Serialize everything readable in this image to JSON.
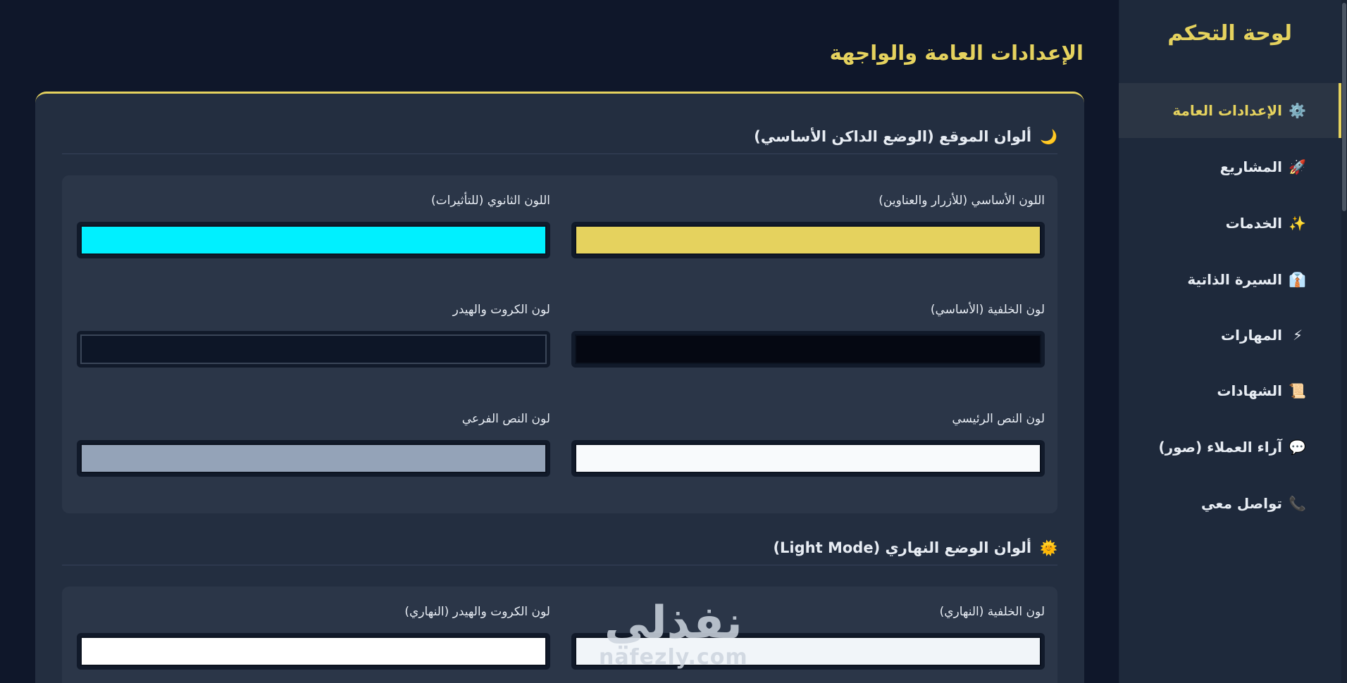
{
  "sidebar": {
    "title": "لوحة التحكم",
    "items": [
      {
        "label": "الإعدادات العامة",
        "icon": "⚙️",
        "active": true
      },
      {
        "label": "المشاريع",
        "icon": "🚀"
      },
      {
        "label": "الخدمات",
        "icon": "✨"
      },
      {
        "label": "السيرة الذاتية",
        "icon": "👔"
      },
      {
        "label": "المهارات",
        "icon": "⚡"
      },
      {
        "label": "الشهادات",
        "icon": "📜"
      },
      {
        "label": "آراء العملاء (صور)",
        "icon": "💬"
      },
      {
        "label": "تواصل معي",
        "icon": "📞"
      }
    ]
  },
  "main": {
    "title": "الإعدادات العامة والواجهة",
    "dark_section": {
      "icon": "🌙",
      "title": "ألوان الموقع (الوضع الداكن الأساسي)",
      "fields": [
        {
          "label": "اللون الأساسي (للأزرار والعناوين)",
          "color": "#e5d25e"
        },
        {
          "label": "اللون الثانوي (للتأثيرات)",
          "color": "#00f0ff"
        },
        {
          "label": "لون الخلفية (الأساسي)",
          "color": "#050812"
        },
        {
          "label": "لون الكروت والهيدر",
          "color": "#0d1627"
        },
        {
          "label": "لون النص الرئيسي",
          "color": "#f8fafc"
        },
        {
          "label": "لون النص الفرعي",
          "color": "#94a3b8"
        }
      ]
    },
    "light_section": {
      "icon": "🌞",
      "title": "ألوان الوضع النهاري (Light Mode)",
      "fields": [
        {
          "label": "لون الخلفية (النهاري)",
          "color": "#f1f5f9"
        },
        {
          "label": "لون الكروت والهيدر (النهاري)",
          "color": "#ffffff"
        }
      ]
    }
  },
  "watermark": {
    "arabic": "نفذلي",
    "latin": "nafezly.com"
  }
}
